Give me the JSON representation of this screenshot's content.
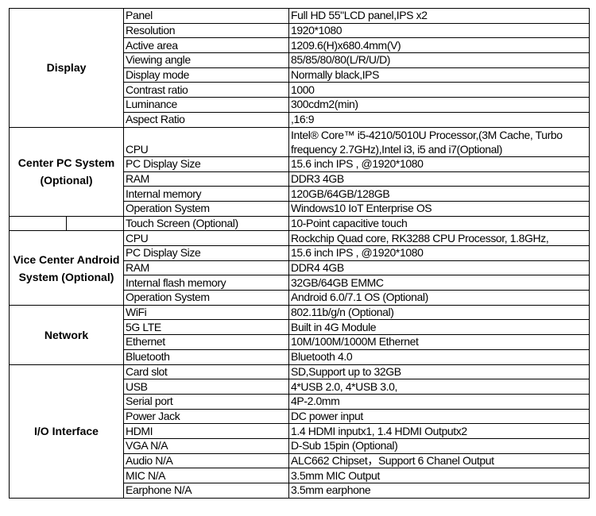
{
  "groups": [
    {
      "title": "Display",
      "rows": [
        {
          "label": "Panel",
          "value": "Full HD 55\"LCD panel,IPS x2"
        },
        {
          "label": "Resolution",
          "value": "1920*1080"
        },
        {
          "label": "Active area",
          "value": "1209.6(H)x680.4mm(V)"
        },
        {
          "label": "Viewing angle",
          "value": "85/85/80/80(L/R/U/D)"
        },
        {
          "label": "Display mode",
          "value": "Normally black,IPS"
        },
        {
          "label": "Contrast ratio",
          "value": "1000"
        },
        {
          "label": "Luminance",
          "value": "300cdm2(min)"
        },
        {
          "label": "Aspect Ratio",
          "value": ",16:9"
        }
      ]
    },
    {
      "title": "Center PC System (Optional)",
      "rows": [
        {
          "label": "CPU",
          "value": "Intel® Core™ i5-4210/5010U Processor,(3M Cache, Turbo frequency 2.7GHz),Intel i3, i5 and i7(Optional)",
          "tall": true
        },
        {
          "label": "PC Display Size",
          "value": "15.6 inch IPS , @1920*1080"
        },
        {
          "label": "RAM",
          "value": "DDR3 4GB"
        },
        {
          "label": "Internal memory",
          "value": "120GB/64GB/128GB"
        },
        {
          "label": "Operation System",
          "value": "Windows10 IoT Enterprise OS"
        }
      ]
    },
    {
      "title": "",
      "split": true,
      "rows": [
        {
          "label": "Touch Screen (Optional)",
          "value": "10-Point capacitive touch"
        }
      ]
    },
    {
      "title": "Vice Center Android System (Optional)",
      "rows": [
        {
          "label": "CPU",
          "value": "Rockchip Quad core, RK3288 CPU Processor, 1.8GHz,"
        },
        {
          "label": "PC Display Size",
          "value": "15.6 inch IPS , @1920*1080"
        },
        {
          "label": "RAM",
          "value": "DDR4 4GB"
        },
        {
          "label": "Internal flash memory",
          "value": "32GB/64GB EMMC"
        },
        {
          "label": "Operation System",
          "value": "Android 6.0/7.1 OS (Optional)"
        }
      ]
    },
    {
      "title": "Network",
      "rows": [
        {
          "label": "WiFi",
          "value": "802.11b/g/n  (Optional)"
        },
        {
          "label": "5G LTE",
          "value": "Built in 4G Module"
        },
        {
          "label": "Ethernet",
          "value": "10M/100M/1000M Ethernet"
        },
        {
          "label": "Bluetooth",
          "value": "Bluetooth 4.0"
        }
      ]
    },
    {
      "title": "I/O Interface",
      "rows": [
        {
          "label": "Card slot",
          "value": "SD,Support up to 32GB"
        },
        {
          "label": "USB",
          "value": "4*USB  2.0, 4*USB  3.0,"
        },
        {
          "label": "Serial port",
          "value": "4P-2.0mm"
        },
        {
          "label": "Power Jack",
          "value": "DC power input"
        },
        {
          "label": "HDMI",
          "value": "1.4  HDMI inputx1, 1.4 HDMI Outputx2"
        },
        {
          "label": "VGA  N/A",
          "value": "D-Sub 15pin (Optional)"
        },
        {
          "label": "Audio  N/A",
          "value": "ALC662 Chipset，Support 6 Chanel Output"
        },
        {
          "label": "MIC  N/A",
          "value": "3.5mm MIC Output"
        },
        {
          "label": "Earphone  N/A",
          "value": "3.5mm earphone"
        }
      ]
    }
  ]
}
